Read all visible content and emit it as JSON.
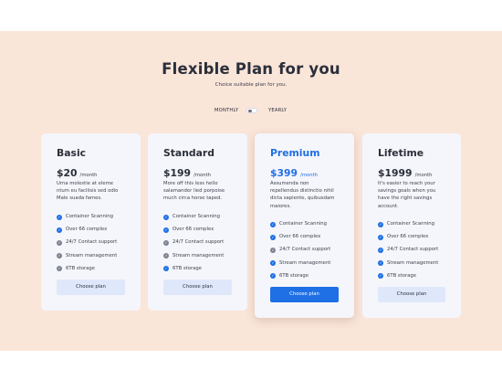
{
  "header": {
    "title": "Flexible Plan for you",
    "subtitle": "Choice suitable plan for you."
  },
  "billing_toggle": {
    "left_label": "MONTHLY",
    "right_label": "YEARLY",
    "selected": "MONTHLY"
  },
  "colors": {
    "band_bg": "#fae5d9",
    "accent": "#1f6fe5",
    "card_bg": "#f5f6fb",
    "button_bg": "#dfe8fb",
    "check_off": "#7c8290"
  },
  "plans": [
    {
      "name": "Basic",
      "price": "$20",
      "period": "/month",
      "description": "Urna molestie at eleme ntum eu facilisis sed odio Male suada fames.",
      "features": [
        {
          "label": "Container Scanning",
          "included": true
        },
        {
          "label": "Over 66 complex",
          "included": true
        },
        {
          "label": "24/7 Contact support",
          "included": false
        },
        {
          "label": "Stream management",
          "included": false
        },
        {
          "label": "6TB storage",
          "included": false
        }
      ],
      "button": "Choose plan"
    },
    {
      "name": "Standard",
      "price": "$199",
      "period": "/month",
      "description": "More off this less hello salamander lied porpoise much circa horse taped.",
      "features": [
        {
          "label": "Container Scanning",
          "included": true
        },
        {
          "label": "Over 66 complex",
          "included": true
        },
        {
          "label": "24/7 Contact support",
          "included": false
        },
        {
          "label": "Stream management",
          "included": false
        },
        {
          "label": "6TB storage",
          "included": true
        }
      ],
      "button": "Choose plan"
    },
    {
      "name": "Premium",
      "price": "$399",
      "period": "/month",
      "description": "Assumenda non repellendus distinctio nihil dicta sapiente, quibusdam maiores.",
      "features": [
        {
          "label": "Container Scanning",
          "included": true
        },
        {
          "label": "Over 66 complex",
          "included": true
        },
        {
          "label": "24/7 Contact support",
          "included": false
        },
        {
          "label": "Stream management",
          "included": true
        },
        {
          "label": "6TB storage",
          "included": true
        }
      ],
      "button": "Choose plan"
    },
    {
      "name": "Lifetime",
      "price": "$1999",
      "period": "/month",
      "description": "It's easier to reach your savings goals when you have the right savings account.",
      "features": [
        {
          "label": "Container Scanning",
          "included": true
        },
        {
          "label": "Over 66 complex",
          "included": true
        },
        {
          "label": "24/7 Contact support",
          "included": true
        },
        {
          "label": "Stream management",
          "included": true
        },
        {
          "label": "6TB storage",
          "included": true
        }
      ],
      "button": "Choose plan"
    }
  ]
}
